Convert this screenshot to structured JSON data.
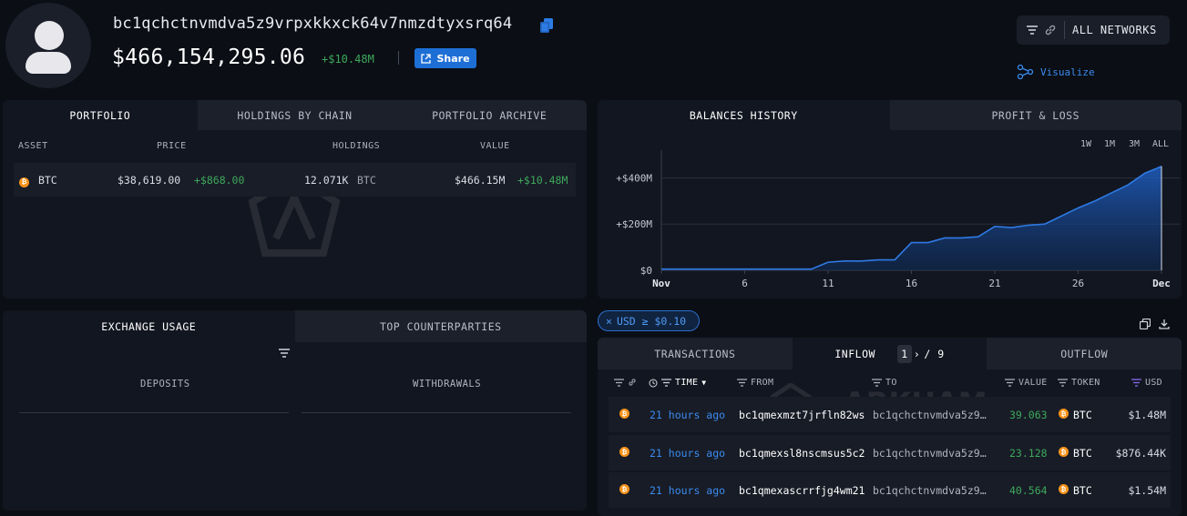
{
  "header": {
    "address": "bc1qchctnvmdva5z9vrpxkkxck64v7nmzdtyxsrq64",
    "balance": "$466,154,295.06",
    "balance_change": "+$10.48M",
    "share_label": "Share",
    "networks_label": "ALL NETWORKS",
    "visualize_label": "Visualize"
  },
  "portfolio": {
    "tabs": [
      "PORTFOLIO",
      "HOLDINGS BY CHAIN",
      "PORTFOLIO ARCHIVE"
    ],
    "columns": [
      "ASSET",
      "PRICE",
      "HOLDINGS",
      "VALUE"
    ],
    "rows": [
      {
        "asset": "BTC",
        "price": "$38,619.00",
        "price_change": "+$868.00",
        "holdings": "12.071K",
        "holdings_unit": "BTC",
        "value": "$466.15M",
        "value_change": "+$10.48M"
      }
    ]
  },
  "history": {
    "tabs": [
      "BALANCES HISTORY",
      "PROFIT & LOSS"
    ],
    "ranges": [
      "1W",
      "1M",
      "3M",
      "ALL"
    ]
  },
  "chart_data": {
    "type": "area",
    "x": [
      "Nov 1",
      "Nov 2",
      "Nov 3",
      "Nov 4",
      "Nov 5",
      "Nov 6",
      "Nov 7",
      "Nov 8",
      "Nov 9",
      "Nov 10",
      "Nov 11",
      "Nov 12",
      "Nov 13",
      "Nov 14",
      "Nov 15",
      "Nov 16",
      "Nov 17",
      "Nov 18",
      "Nov 19",
      "Nov 20",
      "Nov 21",
      "Nov 22",
      "Nov 23",
      "Nov 24",
      "Nov 25",
      "Nov 26",
      "Nov 27",
      "Nov 28",
      "Nov 29",
      "Nov 30",
      "Dec 1"
    ],
    "values": [
      5,
      5,
      5,
      5,
      5,
      5,
      5,
      5,
      5,
      5,
      35,
      40,
      40,
      45,
      45,
      120,
      120,
      140,
      140,
      145,
      190,
      185,
      195,
      200,
      235,
      270,
      300,
      335,
      370,
      420,
      450
    ],
    "x_tick_labels": [
      "Nov",
      "6",
      "11",
      "16",
      "21",
      "26",
      "Dec"
    ],
    "y_tick_labels": [
      "$0",
      "+$200M",
      "+$400M"
    ],
    "ylim": [
      0,
      520
    ],
    "grid": true,
    "color": "#2f7ae5"
  },
  "exchange": {
    "tabs": [
      "EXCHANGE USAGE",
      "TOP COUNTERPARTIES"
    ],
    "columns": [
      "DEPOSITS",
      "WITHDRAWALS"
    ]
  },
  "transactions": {
    "filter_label": "USD ≥ $0.10",
    "tabs": [
      "TRANSACTIONS",
      "INFLOW",
      "OUTFLOW"
    ],
    "page_current": "1",
    "page_total": "/ 9",
    "columns": {
      "time": "TIME",
      "from": "FROM",
      "to": "TO",
      "value": "VALUE",
      "token": "TOKEN",
      "usd": "USD"
    },
    "rows": [
      {
        "time": "21 hours ago",
        "from": "bc1qmexmzt7jrfln82ws",
        "to": "bc1qchctnvmdva5z9…",
        "value": "39.063",
        "token": "BTC",
        "usd": "$1.48M"
      },
      {
        "time": "21 hours ago",
        "from": "bc1qmexsl8nscmsus5c2",
        "to": "bc1qchctnvmdva5z9…",
        "value": "23.128",
        "token": "BTC",
        "usd": "$876.44K"
      },
      {
        "time": "21 hours ago",
        "from": "bc1qmexascrrfjg4wm21",
        "to": "bc1qchctnvmdva5z9…",
        "value": "40.564",
        "token": "BTC",
        "usd": "$1.54M"
      }
    ],
    "watermark": "ARKHAM"
  },
  "colors": {
    "accent": "#1d6fd6",
    "positive": "#3ea85c",
    "link": "#3a8bf0",
    "bitcoin": "#f7931a"
  }
}
